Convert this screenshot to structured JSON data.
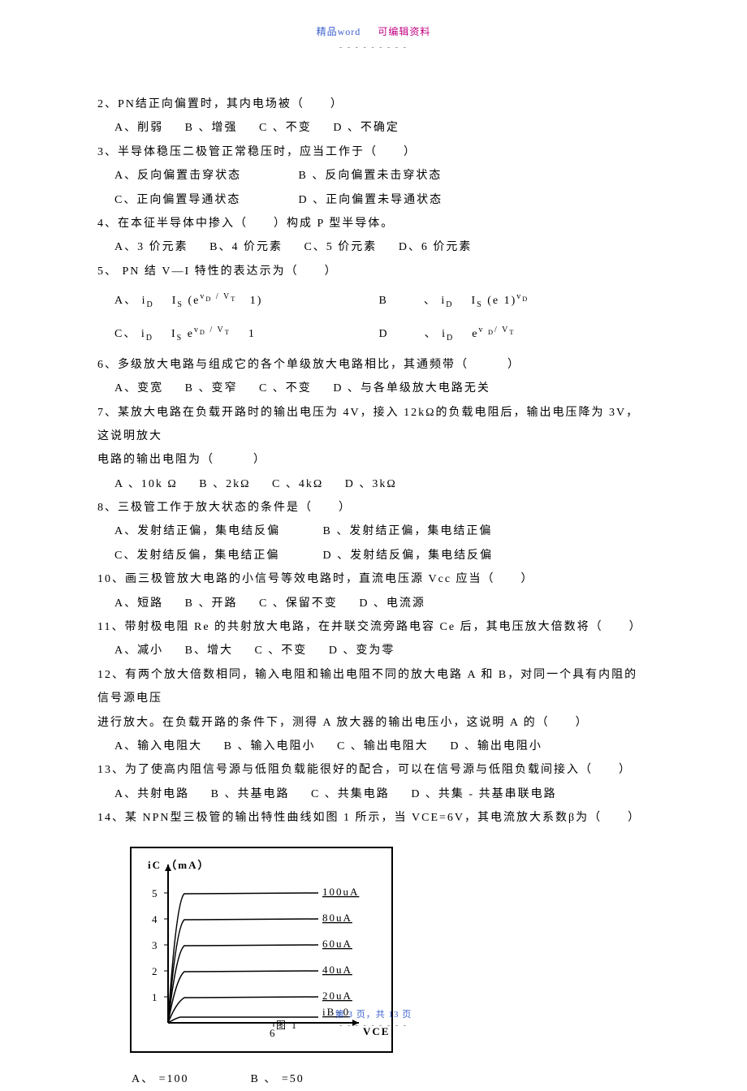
{
  "header": {
    "left": "精品word",
    "right": "可编辑资料"
  },
  "questions": {
    "q2": {
      "stem": "2、PN结正向偏置时，其内电场被（　　）",
      "opts": {
        "A": "A、削弱",
        "B": "B 、增强",
        "C": "C 、不变",
        "D": "D 、不确定"
      }
    },
    "q3": {
      "stem": "3、半导体稳压二极管正常稳压时，应当工作于（　　）",
      "opts": {
        "A": "A、反向偏置击穿状态",
        "B": "B 、反向偏置未击穿状态",
        "C": "C、正向偏置导通状态",
        "D": "D 、正向偏置未导通状态"
      }
    },
    "q4": {
      "stem": "4、在本征半导体中掺入（　　）构成 P 型半导体。",
      "opts": {
        "A": "A、3 价元素",
        "B": "B、4 价元素",
        "C": "C、5 价元素",
        "D": "D、6 价元素"
      }
    },
    "q5": {
      "stem": "5、 PN 结 V—I 特性的表达示为（　　）",
      "formulas": {
        "A_lhs": "A、 i",
        "A_sub": "D",
        "A_eqIs": "I",
        "A_Ssub": "S",
        "A_exp_top1": "v",
        "A_exp_sub1": "D",
        "A_exp_top2": " / V",
        "A_exp_sub2": "T",
        "A_tail": " 1)",
        "B_label": "B",
        "B_punc": "、",
        "B_lhs": "i",
        "B_sub": "D",
        "B_eqIs": "I",
        "B_Ssub": "S",
        "B_mid": "(e  1)",
        "B_exp_top": "v",
        "B_exp_sub": "D",
        "C_label": "C、",
        "C_lhs": "i",
        "C_sub": "D",
        "C_eqIs": "I",
        "C_Ssub": "S",
        "C_mid": "e",
        "C_exp_top1": "v",
        "C_exp_sub1": "D",
        "C_exp_top2": " / V",
        "C_exp_sub2": "T",
        "C_tail": " 1",
        "D_label": "D",
        "D_punc": "、",
        "D_lhs": "i",
        "D_sub": "D",
        "D_mid": "e",
        "D_exp_top1": "v ",
        "D_exp_sub1": "D",
        "D_exp_top2": "/ V",
        "D_exp_sub2": "T"
      }
    },
    "q6": {
      "stem": "6、多级放大电路与组成它的各个单级放大电路相比，其通频带（　　　）",
      "opts": {
        "A": "A、变宽",
        "B": "B 、变窄",
        "C": "C 、不变",
        "D": "D 、与各单级放大电路无关"
      }
    },
    "q7": {
      "stem1": "7、某放大电路在负载开路时的输出电压为   4V，接入 12kΩ的负载电阻后，输出电压降为   3V，这说明放大",
      "stem2": "电路的输出电阻为（　　　）",
      "opts": {
        "A": "A 、10k Ω",
        "B": "B 、2kΩ",
        "C": "C 、4kΩ",
        "D": "D 、3kΩ"
      }
    },
    "q8": {
      "stem": "8、三极管工作于放大状态的条件是（　　）",
      "opts": {
        "A": "A、发射结正偏，集电结反偏",
        "B": "B 、发射结正偏，集电结正偏",
        "C": "C、发射结反偏，集电结正偏",
        "D": "D 、发射结反偏，集电结反偏"
      }
    },
    "q10": {
      "stem": "10、画三极管放大电路的小信号等效电路时，直流电压源   Vcc 应当（　　）",
      "opts": {
        "A": "A、短路",
        "B": "B 、开路",
        "C": "C 、保留不变",
        "D": "D 、电流源"
      }
    },
    "q11": {
      "stem": "11、带射极电阻  Re 的共射放大电路，在并联交流旁路电容   Ce 后，其电压放大倍数将（　　）",
      "opts": {
        "A": "A、减小",
        "B": "B、增大",
        "C": "C 、不变",
        "D": "D 、变为零"
      }
    },
    "q12": {
      "stem1": "12、有两个放大倍数相同，输入电阻和输出电阻不同的放大电路   A 和 B，对同一个具有内阻的信号源电压",
      "stem2": "进行放大。在负载开路的条件下，测得   A 放大器的输出电压小，这说明   A 的（　　）",
      "opts": {
        "A": "A、输入电阻大",
        "B": "B 、输入电阻小",
        "C": "C 、输出电阻大",
        "D": "D 、输出电阻小"
      }
    },
    "q13": {
      "stem": "13、为了使高内阻信号源与低阻负载能很好的配合，可以在信号源与低阻负载间接入（　　）",
      "opts": {
        "A": "A、共射电路",
        "B": "B 、共基电路",
        "C": "C 、共集电路",
        "D": "D 、共集 - 共基串联电路"
      }
    },
    "q14": {
      "stem": "14、某 NPN型三极管的输出特性曲线如图   1 所示，当 VCE=6V，其电流放大系数β为（　　）",
      "opts": {
        "A": "A、  =100",
        "B": "B 、  =50"
      }
    }
  },
  "chart_data": {
    "type": "line",
    "title": "图 1",
    "xlabel": "VCE （V）",
    "ylabel": "iC （mA）",
    "x_ticks": [
      "6"
    ],
    "y_ticks": [
      "1",
      "2",
      "3",
      "4",
      "5"
    ],
    "series": [
      {
        "name": "iB=0",
        "y_plateau_mA": 0.1
      },
      {
        "name": "20uA",
        "y_plateau_mA": 1
      },
      {
        "name": "40uA",
        "y_plateau_mA": 2
      },
      {
        "name": "60uA",
        "y_plateau_mA": 3
      },
      {
        "name": "80uA",
        "y_plateau_mA": 4
      },
      {
        "name": "100uA",
        "y_plateau_mA": 5
      }
    ],
    "xlim": [
      0,
      8
    ],
    "ylim": [
      0,
      5.5
    ]
  },
  "footer": {
    "text": "第 3 页，共 13 页"
  }
}
